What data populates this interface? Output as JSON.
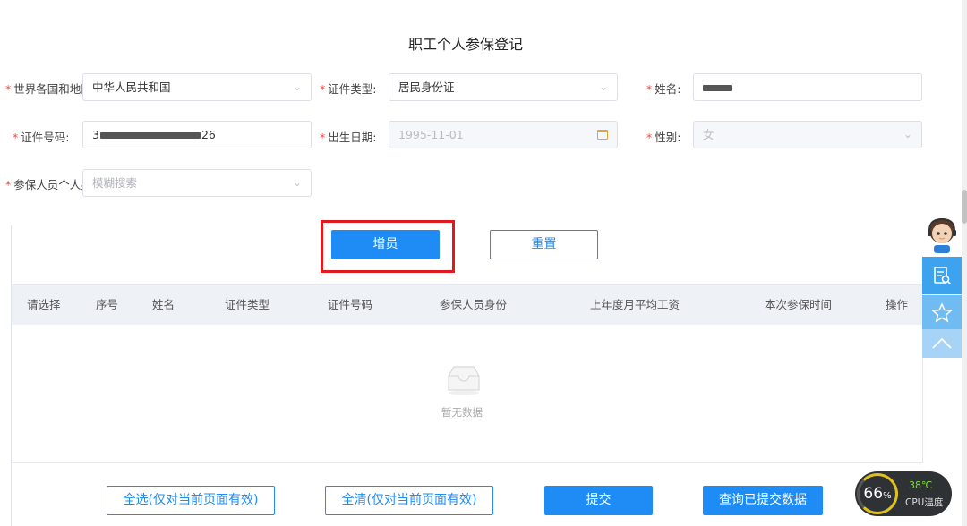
{
  "form": {
    "title": "职工个人参保登记",
    "country_label": "世界各国和地区",
    "country_value": "中华人民共和国",
    "id_type_label": "证件类型:",
    "id_type_value": "居民身份证",
    "name_label": "姓名:",
    "id_number_label": "证件号码:",
    "id_number_prefix": "3",
    "id_number_suffix": "26",
    "birth_label": "出生日期:",
    "birth_value": "1995-11-01",
    "gender_label": "性别:",
    "gender_value": "女",
    "identity_label": "参保人员个人身份",
    "identity_placeholder": "模糊搜索",
    "required_mark": "*"
  },
  "actions": {
    "add_label": "增员",
    "reset_label": "重置"
  },
  "table": {
    "columns": [
      "请选择",
      "序号",
      "姓名",
      "证件类型",
      "证件号码",
      "参保人员身份",
      "上年度月平均工资",
      "本次参保时间",
      "操作"
    ],
    "empty_text": "暂无数据"
  },
  "footer": {
    "select_all": "全选(仅对当前页面有效)",
    "clear_all": "全清(仅对当前页面有效)",
    "submit": "提交",
    "query_submitted": "查询已提交数据"
  },
  "cpu_widget": {
    "usage": "66",
    "usage_unit": "%",
    "temperature": "38℃",
    "label": "CPU温度"
  },
  "colors": {
    "primary": "#1e8cf4",
    "required": "#f5483b",
    "highlight": "#e0191e"
  }
}
